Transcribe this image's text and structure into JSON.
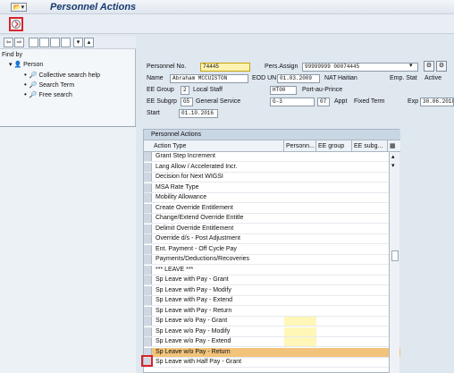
{
  "window": {
    "title": "Personnel Actions"
  },
  "toolbar": {
    "menu_icon": "📂▾"
  },
  "left_panel": {
    "find_by": "Find by",
    "tree_root": "Person",
    "items": [
      "Collective search help",
      "Search Term",
      "Free search"
    ]
  },
  "header": {
    "personnel_no_label": "Personnel No.",
    "personnel_no_value": "74445",
    "pers_assign_label": "Pers.Assign",
    "pers_assign_value": "99999999 00074445",
    "name_label": "Name",
    "name_value": "Abraham MCCUISTON",
    "eod_label": "EOD UN",
    "eod_value": "01.03.2009",
    "nat_label": "NAT",
    "nat_value": "Haitian",
    "emp_stat_label": "Emp. Stat",
    "emp_stat_value": "Active",
    "ee_group_label": "EE Group",
    "ee_group_value": "2",
    "ee_group_text": "Local Staff",
    "ht_code": "HT00",
    "ht_text": "Port-au-Prince",
    "ee_subgrp_label": "EE Subgrp",
    "ee_subgrp_value": "G5",
    "ee_subgrp_text": "General Service",
    "grade": "G-3",
    "step": "07",
    "appt_label": "Appt",
    "appt_text": "Fixed Term",
    "exp_label": "Exp",
    "exp_value": "30.06.2018",
    "start_label": "Start",
    "start_value": "01.10.2016"
  },
  "table": {
    "caption": "Personnel Actions",
    "columns": [
      "Action Type",
      "Personn...",
      "EE group",
      "EE subg..."
    ],
    "rows": [
      "Grant Step Increment",
      "Lang Allow / Accelerated Incr.",
      "Decision for Next WIGSI",
      "MSA Rate Type",
      "Mobility Allowance",
      "Create Override Entitlement",
      "Change/Extend Override Entitle",
      "Delimit Override Entitlement",
      "Override d/s - Post Adjustment",
      "Ent. Payment - Off Cycle Pay",
      "Payments/Deductions/Recoveries",
      "*** LEAVE ***",
      "Sp Leave with Pay - Grant",
      "Sp Leave with Pay - Modify",
      "Sp Leave with Pay - Extend",
      "Sp Leave with Pay - Return",
      "Sp Leave w/o Pay - Grant",
      "Sp Leave w/o Pay - Modify",
      "Sp Leave w/o Pay - Extend",
      "Sp Leave w/o Pay - Return",
      "Sp Leave with Half Pay - Grant"
    ]
  }
}
